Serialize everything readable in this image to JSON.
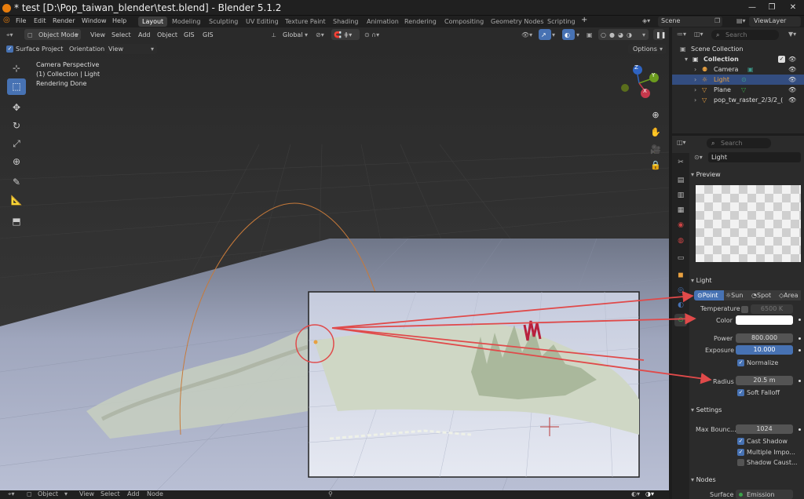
{
  "app": {
    "title": "* test [D:\\Pop_taiwan_blender\\test.blend] - Blender 5.1.2"
  },
  "menu": [
    "File",
    "Edit",
    "Render",
    "Window",
    "Help"
  ],
  "workspaces": [
    "Layout",
    "Modeling",
    "Sculpting",
    "UV Editing",
    "Texture Paint",
    "Shading",
    "Animation",
    "Rendering",
    "Compositing",
    "Geometry Nodes",
    "Scripting"
  ],
  "scene": {
    "label": "Scene",
    "view_layer": "ViewLayer"
  },
  "viewport_header": {
    "mode": "Object Mode",
    "menus": [
      "View",
      "Select",
      "Add",
      "Object",
      "GIS",
      "GIS"
    ],
    "orientation": "Global"
  },
  "subheader": {
    "surface_project": "Surface Project",
    "orientation_label": "Orientation:",
    "orientation_value": "View",
    "options": "Options"
  },
  "overlay_text": [
    "Camera Perspective",
    "(1) Collection | Light",
    "Rendering Done"
  ],
  "gizmo": {
    "z": "Z",
    "y": "Y",
    "x": "X"
  },
  "outliner": {
    "search_placeholder": "Search",
    "items": [
      "Scene Collection",
      "Collection",
      "Camera",
      "Light",
      "Plane",
      "pop_tw_raster_2/3/2_("
    ]
  },
  "properties": {
    "search_placeholder": "Search",
    "object_name": "Light",
    "preview_label": "Preview",
    "light_label": "Light",
    "light_types": [
      "Point",
      "Sun",
      "Spot",
      "Area"
    ],
    "temperature_label": "Temperature",
    "temperature_value": "6500 K",
    "color_label": "Color",
    "power_label": "Power",
    "power_value": "800.000",
    "exposure_label": "Exposure",
    "exposure_value": "10.000",
    "normalize_label": "Normalize",
    "radius_label": "Radius",
    "radius_value": "20.5 m",
    "soft_falloff_label": "Soft Falloff",
    "settings_label": "Settings",
    "max_bounces_label": "Max Bounc...",
    "max_bounces_value": "1024",
    "cast_shadow_label": "Cast Shadow",
    "multiple_importance_label": "Multiple Impo...",
    "shadow_caustics_label": "Shadow Caust...",
    "nodes_label": "Nodes",
    "surface_label": "Surface",
    "surface_value": "Emission"
  },
  "statusbar": {
    "mode": "Object",
    "menus": [
      "View",
      "Select",
      "Add",
      "Node"
    ]
  },
  "colors": {
    "accent": "#4772b3",
    "annotation": "#e04a4a",
    "selected_row": "#334d80",
    "light_orange": "#e8a040"
  }
}
